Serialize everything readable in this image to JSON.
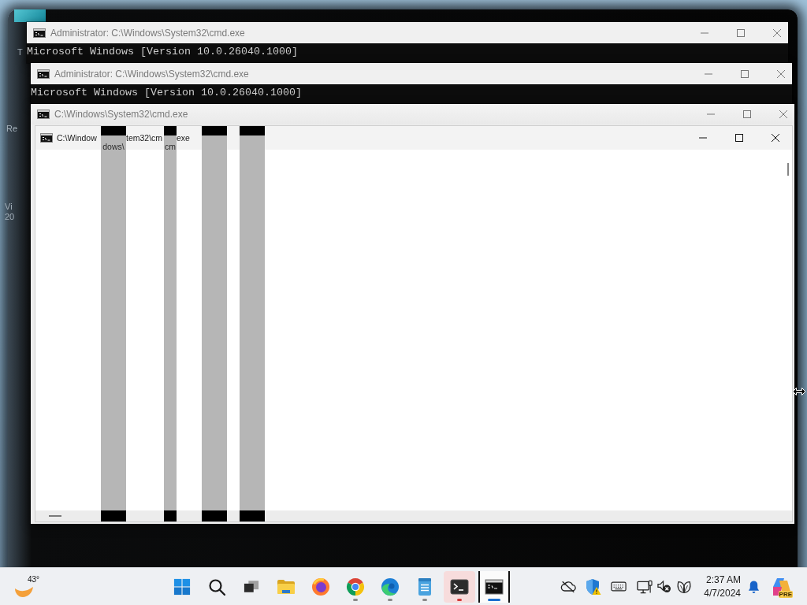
{
  "desktop": {
    "edge_texts": [
      "T",
      "Re",
      "Vi",
      "20"
    ]
  },
  "windows": [
    {
      "kind": "console",
      "title": "Administrator: C:\\Windows\\System32\\cmd.exe",
      "active": false,
      "console_lines": [
        "Microsoft Windows [Version 10.0.26040.1000]"
      ]
    },
    {
      "kind": "console",
      "title": "Administrator: C:\\Windows\\System32\\cmd.exe",
      "active": false,
      "console_lines": [
        "Microsoft Windows [Version 10.0.26040.1000]"
      ]
    },
    {
      "kind": "host",
      "title": "C:\\Windows\\System32\\cmd.exe",
      "active": false,
      "inner_window": {
        "active": true,
        "title_fragments": [
          "C:\\Window",
          "tem32\\cm",
          "exe"
        ],
        "stripe_texts": [
          "dows\\",
          "cm"
        ]
      }
    }
  ],
  "taskbar": {
    "weather": {
      "temperature": "43°"
    },
    "apps": [
      {
        "running": false,
        "selected": false,
        "alert": false
      },
      {
        "running": false,
        "selected": false,
        "alert": false
      },
      {
        "running": false,
        "selected": false,
        "alert": false
      },
      {
        "running": false,
        "selected": false,
        "alert": false
      },
      {
        "running": false,
        "selected": false,
        "alert": false
      },
      {
        "running": true,
        "selected": false,
        "alert": false
      },
      {
        "running": true,
        "selected": false,
        "alert": false
      },
      {
        "running": true,
        "selected": false,
        "alert": false
      },
      {
        "running": true,
        "selected": false,
        "alert": true
      },
      {
        "running": true,
        "selected": true,
        "alert": false
      }
    ],
    "clock": {
      "time": "2:37 AM",
      "date": "4/7/2024"
    },
    "copilot": {
      "badge": "PRE"
    }
  }
}
